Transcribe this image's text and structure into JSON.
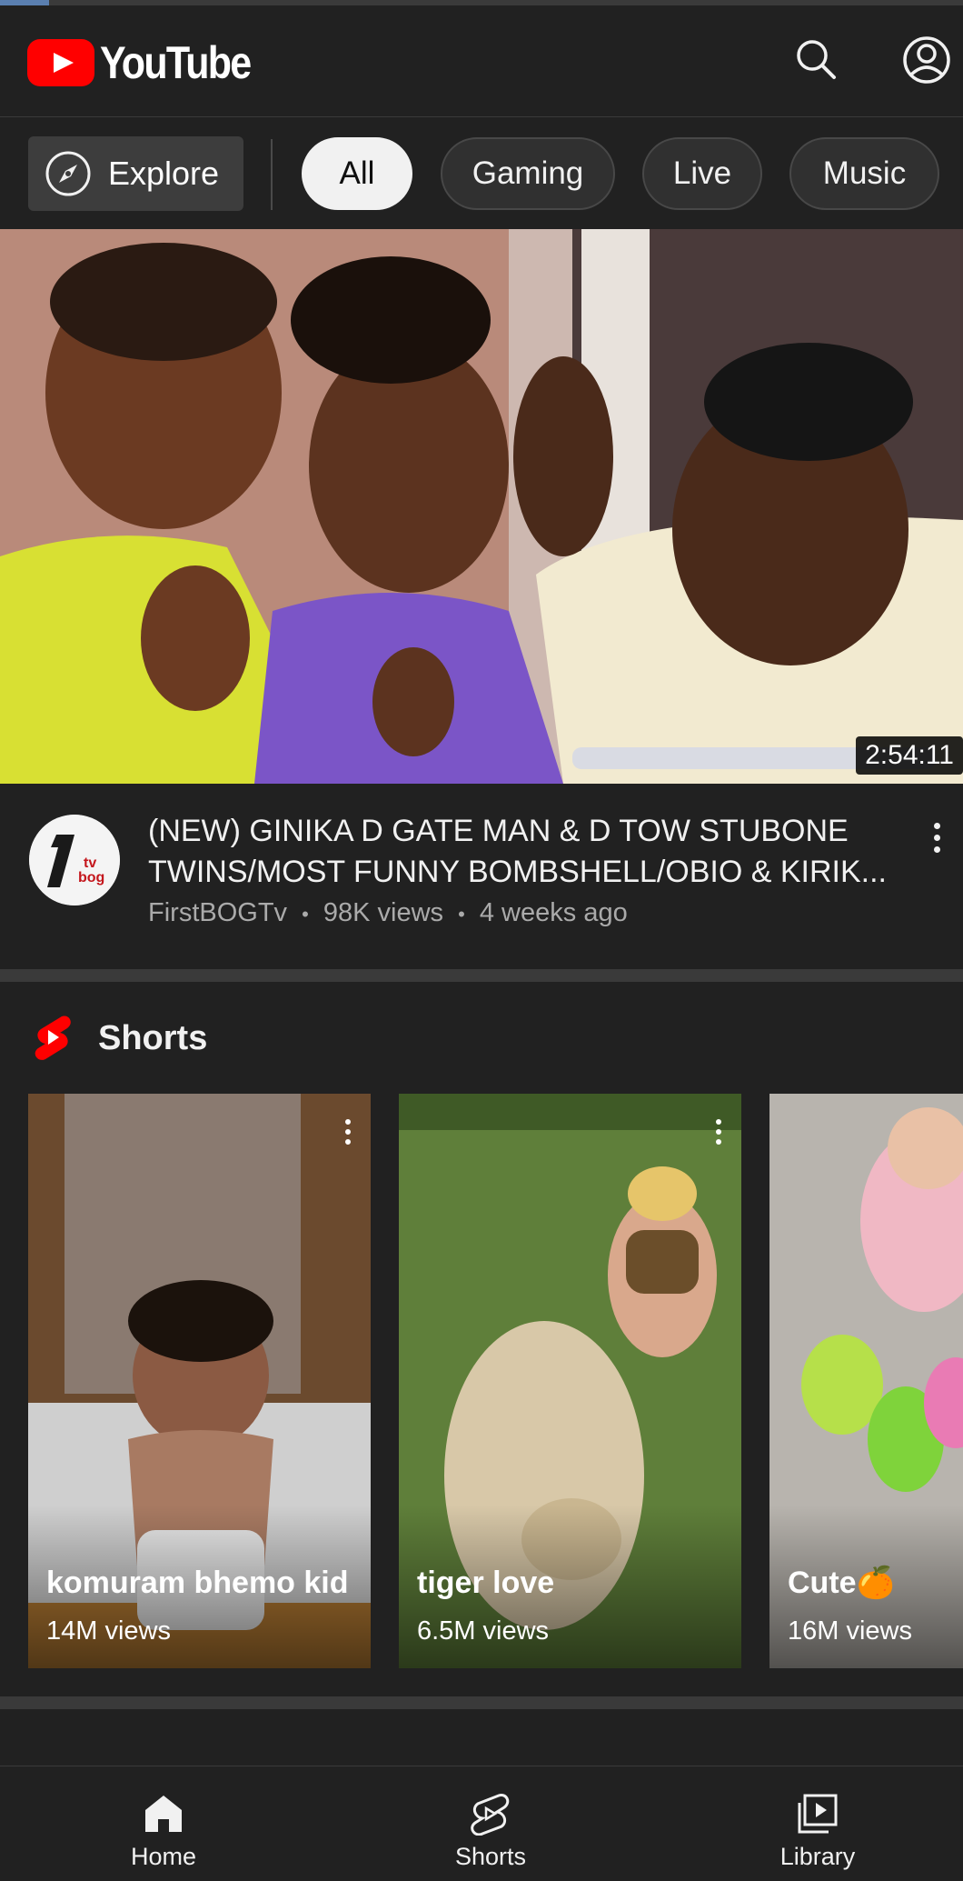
{
  "header": {
    "logo_text": "YouTube",
    "search_icon": "search-icon",
    "account_icon": "account-circle-icon"
  },
  "chips": {
    "explore_label": "Explore",
    "items": [
      {
        "label": "All",
        "active": true
      },
      {
        "label": "Gaming",
        "active": false
      },
      {
        "label": "Live",
        "active": false
      },
      {
        "label": "Music",
        "active": false
      }
    ]
  },
  "featured_video": {
    "duration": "2:54:11",
    "title": "(NEW) GINIKA D GATE MAN & D TOW STUBONE TWINS/MOST FUNNY BOMBSHELL/OBIO & KIRIK...",
    "channel": "FirstBOGTv",
    "views": "98K views",
    "age": "4 weeks ago",
    "separator": "•",
    "avatar_text": "tv bog"
  },
  "shorts": {
    "heading": "Shorts",
    "items": [
      {
        "title": "komuram bhemo kid",
        "views": "14M views"
      },
      {
        "title": "tiger love",
        "views": "6.5M views"
      },
      {
        "title": "Cute🍊",
        "views": "16M views"
      }
    ]
  },
  "bottom_nav": {
    "items": [
      {
        "label": "Home",
        "icon": "home-icon",
        "active": true
      },
      {
        "label": "Shorts",
        "icon": "shorts-icon",
        "active": false
      },
      {
        "label": "Library",
        "icon": "library-icon",
        "active": false
      }
    ]
  },
  "colors": {
    "background": "#212121",
    "brand_red": "#ff0000",
    "chip_active_bg": "#f1f1f1",
    "meta_text": "#aaaaaa"
  }
}
